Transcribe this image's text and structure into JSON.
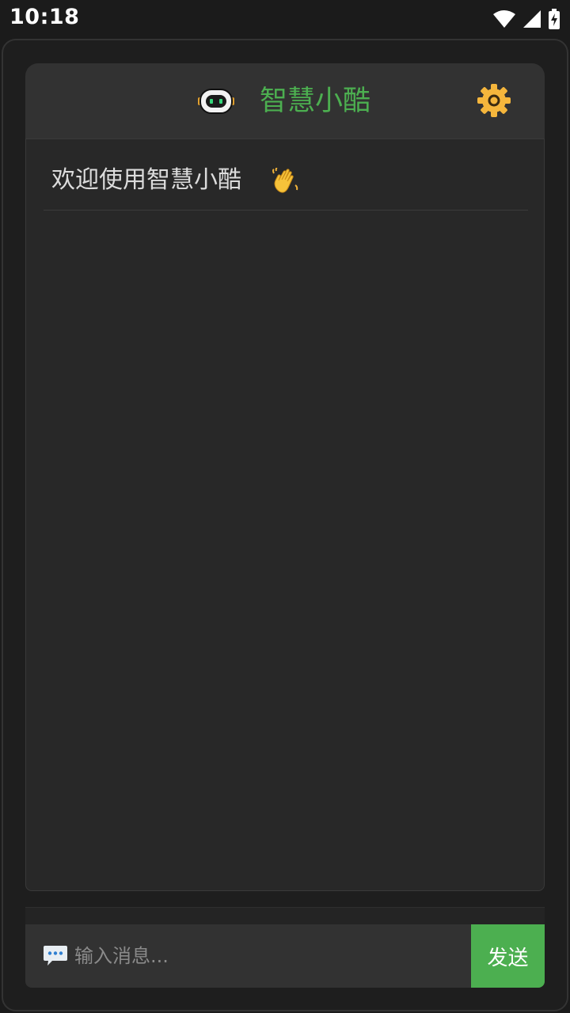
{
  "status_bar": {
    "time": "10:18"
  },
  "header": {
    "title": "智慧小酷",
    "logo_icon": "robot-icon",
    "settings_icon": "gear-icon"
  },
  "chat": {
    "welcome_message": "欢迎使用智慧小酷",
    "welcome_icon": "waving-hand-icon"
  },
  "input": {
    "placeholder": "输入消息...",
    "value": "",
    "icon": "speech-bubble-icon",
    "send_label": "发送"
  },
  "colors": {
    "accent": "#4caf50",
    "settings": "#f5b63c",
    "background": "#1e1e1e",
    "panel": "#323232",
    "chat_bg": "#282828"
  }
}
